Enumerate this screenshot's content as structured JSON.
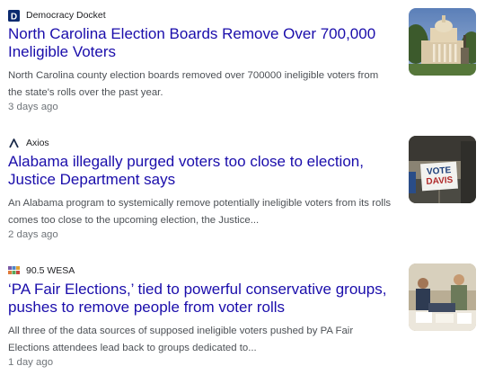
{
  "articles": [
    {
      "source": "Democracy Docket",
      "source_icon": "democracy-docket-logo-icon",
      "headline": "North Carolina Election Boards Remove Over 700,000 Ineligible Voters",
      "snippet": "North Carolina county election boards removed over 700000 ineligible voters from the state's rolls over the past year.",
      "time": "3 days ago",
      "thumbnail": "capitol-building-image"
    },
    {
      "source": "Axios",
      "source_icon": "axios-logo-icon",
      "headline": "Alabama illegally purged voters too close to election, Justice Department says",
      "snippet": "An Alabama program to systemically remove potentially ineligible voters from its rolls comes too close to the upcoming election, the Justice...",
      "time": "2 days ago",
      "thumbnail": "vote-sign-image",
      "thumbnail_sign": "VOTE\nDAVIS"
    },
    {
      "source": "90.5 WESA",
      "source_icon": "wesa-logo-icon",
      "headline": "‘PA Fair Elections,’ tied to powerful conservative groups, pushes to remove people from voter rolls",
      "snippet": "All three of the data sources of supposed ineligible voters pushed by PA Fair Elections attendees lead back to groups dedicated to...",
      "time": "1 day ago",
      "thumbnail": "poll-workers-image"
    }
  ],
  "colors": {
    "headline": "#1a0dab",
    "snippet": "#4d5156",
    "time": "#70757a",
    "source": "#202124"
  }
}
